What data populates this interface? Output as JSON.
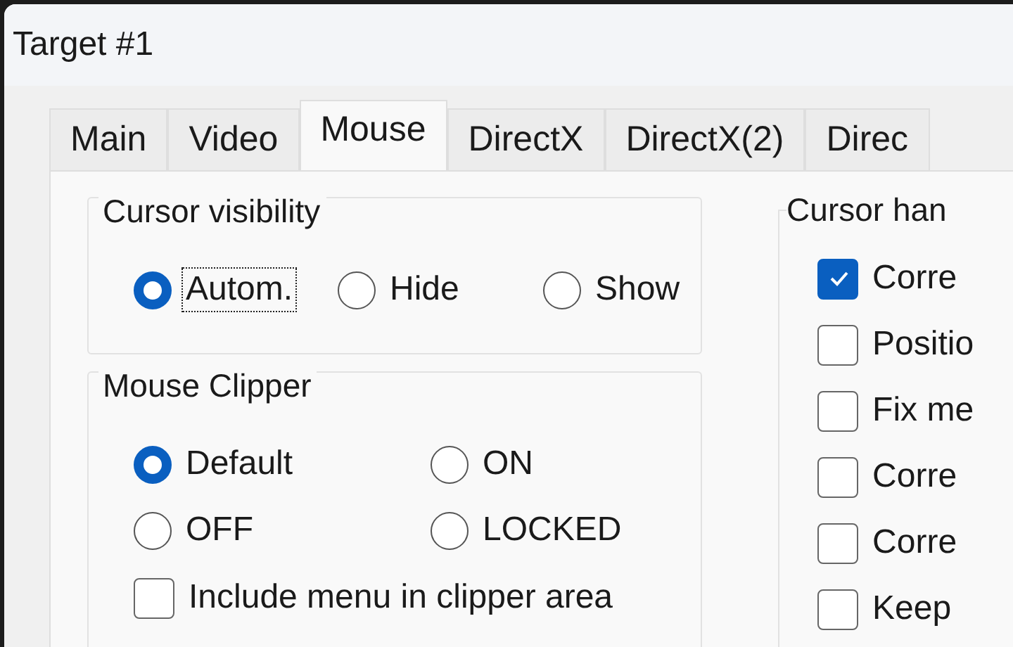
{
  "window": {
    "title": "Target #1"
  },
  "tabs": [
    {
      "label": "Main",
      "selected": false
    },
    {
      "label": "Video",
      "selected": false
    },
    {
      "label": "Mouse",
      "selected": true
    },
    {
      "label": "DirectX",
      "selected": false
    },
    {
      "label": "DirectX(2)",
      "selected": false
    },
    {
      "label": "Direc",
      "selected": false
    }
  ],
  "cursor_visibility": {
    "title": "Cursor visibility",
    "options": [
      {
        "label": "Autom.",
        "selected": true,
        "focused": true
      },
      {
        "label": "Hide",
        "selected": false,
        "focused": false
      },
      {
        "label": "Show",
        "selected": false,
        "focused": false
      }
    ]
  },
  "mouse_clipper": {
    "title": "Mouse Clipper",
    "options": [
      {
        "label": "Default",
        "selected": true
      },
      {
        "label": "ON",
        "selected": false
      },
      {
        "label": "OFF",
        "selected": false
      },
      {
        "label": "LOCKED",
        "selected": false
      }
    ],
    "include_menu": {
      "label": "Include menu in clipper area",
      "checked": false
    }
  },
  "cursor_handling": {
    "title": "Cursor han",
    "checkboxes": [
      {
        "label": "Corre",
        "checked": true
      },
      {
        "label": "Positio",
        "checked": false
      },
      {
        "label": "Fix me",
        "checked": false
      },
      {
        "label": "Corre",
        "checked": false
      },
      {
        "label": "Corre",
        "checked": false
      },
      {
        "label": "Keep",
        "checked": false
      }
    ]
  }
}
